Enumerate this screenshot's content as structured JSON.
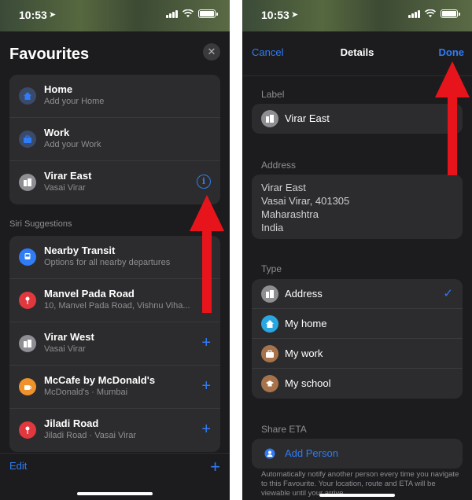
{
  "status": {
    "time": "10:53"
  },
  "left": {
    "title": "Favourites",
    "favourites": [
      {
        "title": "Home",
        "subtitle": "Add your Home",
        "icon": "house-icon",
        "icon_color": "#3a6fd8"
      },
      {
        "title": "Work",
        "subtitle": "Add your Work",
        "icon": "briefcase-icon",
        "icon_color": "#3a6fd8"
      },
      {
        "title": "Virar East",
        "subtitle": "Vasai Virar",
        "icon": "building-icon",
        "icon_color": "#8e8e93"
      }
    ],
    "siri_label": "Siri Suggestions",
    "suggestions": [
      {
        "title": "Nearby Transit",
        "subtitle": "Options for all nearby departures",
        "icon": "train-icon",
        "icon_color": "#2f7cf6"
      },
      {
        "title": "Manvel Pada Road",
        "subtitle": "10, Manvel Pada Road, Vishnu Viha...",
        "icon": "pin-icon",
        "icon_color": "#e0383e"
      },
      {
        "title": "Virar West",
        "subtitle": "Vasai Virar",
        "icon": "building-icon",
        "icon_color": "#8e8e93"
      },
      {
        "title": "McCafe by McDonald's",
        "subtitle": "McDonald's · Mumbai",
        "icon": "cafe-icon",
        "icon_color": "#f0922b"
      },
      {
        "title": "Jiladi Road",
        "subtitle": "Jiladi Road · Vasai Virar",
        "icon": "pin-icon",
        "icon_color": "#e0383e"
      }
    ],
    "edit_label": "Edit"
  },
  "right": {
    "cancel_label": "Cancel",
    "title": "Details",
    "done_label": "Done",
    "label_heading": "Label",
    "label_value": "Virar East",
    "address_heading": "Address",
    "address_lines": [
      "Virar East",
      "Vasai Virar, 401305",
      "Maharashtra",
      "India"
    ],
    "type_heading": "Type",
    "types": [
      {
        "label": "Address",
        "icon": "building-icon",
        "icon_color": "#8e8e93",
        "selected": true
      },
      {
        "label": "My home",
        "icon": "house-icon",
        "icon_color": "#2aa7e0",
        "selected": false
      },
      {
        "label": "My work",
        "icon": "briefcase-icon",
        "icon_color": "#a8734a",
        "selected": false
      },
      {
        "label": "My school",
        "icon": "graduation-cap-icon",
        "icon_color": "#a8734a",
        "selected": false
      }
    ],
    "share_heading": "Share ETA",
    "add_person_label": "Add Person",
    "footnote": "Automatically notify another person every time you navigate to this Favourite. Your location, route and ETA will be viewable until your arrive."
  },
  "colors": {
    "accent": "#2f7cf6",
    "arrow": "#e8141c"
  }
}
